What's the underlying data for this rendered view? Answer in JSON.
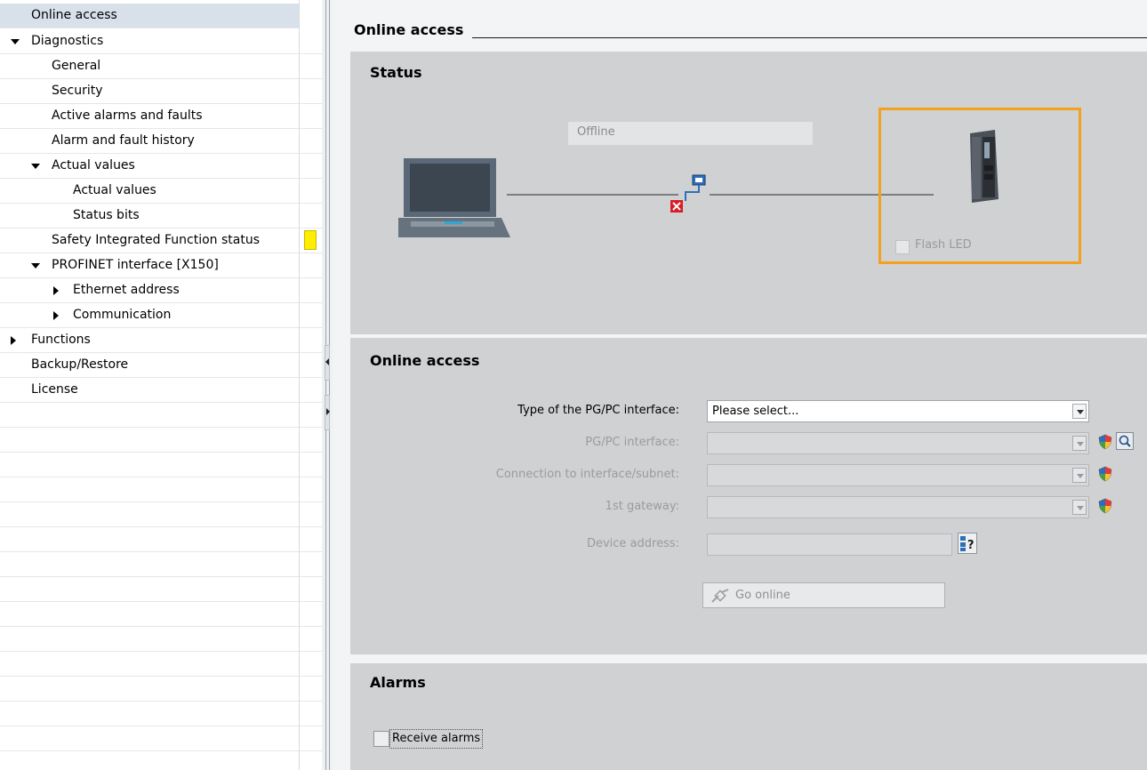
{
  "tree": {
    "items": [
      {
        "label": "Online access",
        "selected": true
      },
      {
        "label": "Diagnostics",
        "expander": "expanded"
      },
      {
        "label": "General"
      },
      {
        "label": "Security"
      },
      {
        "label": "Active alarms and faults"
      },
      {
        "label": "Alarm and fault history"
      },
      {
        "label": "Actual values",
        "expander": "expanded"
      },
      {
        "label": "Actual values"
      },
      {
        "label": "Status bits"
      },
      {
        "label": "Safety Integrated Function status"
      },
      {
        "label": "PROFINET interface [X150]",
        "expander": "expanded"
      },
      {
        "label": "Ethernet address",
        "expander": "collapsed"
      },
      {
        "label": "Communication",
        "expander": "collapsed"
      },
      {
        "label": "Functions",
        "expander": "collapsed"
      },
      {
        "label": "Backup/Restore"
      },
      {
        "label": "License"
      }
    ]
  },
  "page": {
    "title": "Online access"
  },
  "status": {
    "title": "Status",
    "connection_state": "Offline",
    "flash_led_label": "Flash LED",
    "highlight_color": "#f4a21d"
  },
  "online_access": {
    "title": "Online access",
    "fields": [
      {
        "label": "Type of the PG/PC interface:",
        "value": "Please select...",
        "state": "active"
      },
      {
        "label": "PG/PC interface:",
        "value": "",
        "state": "disabled"
      },
      {
        "label": "Connection to interface/subnet:",
        "value": "",
        "state": "disabled"
      },
      {
        "label": "1st gateway:",
        "value": "",
        "state": "disabled"
      },
      {
        "label": "Device address:",
        "value": "",
        "state": "disabled"
      }
    ],
    "go_online_label": "Go online"
  },
  "alarms": {
    "title": "Alarms",
    "receive_alarms_label": "Receive alarms",
    "receive_alarms_checked": false
  },
  "colors": {
    "section_bg": "#cfd1d3",
    "selected_row": "#d8e1ea",
    "status_marker": "#ffee00"
  }
}
